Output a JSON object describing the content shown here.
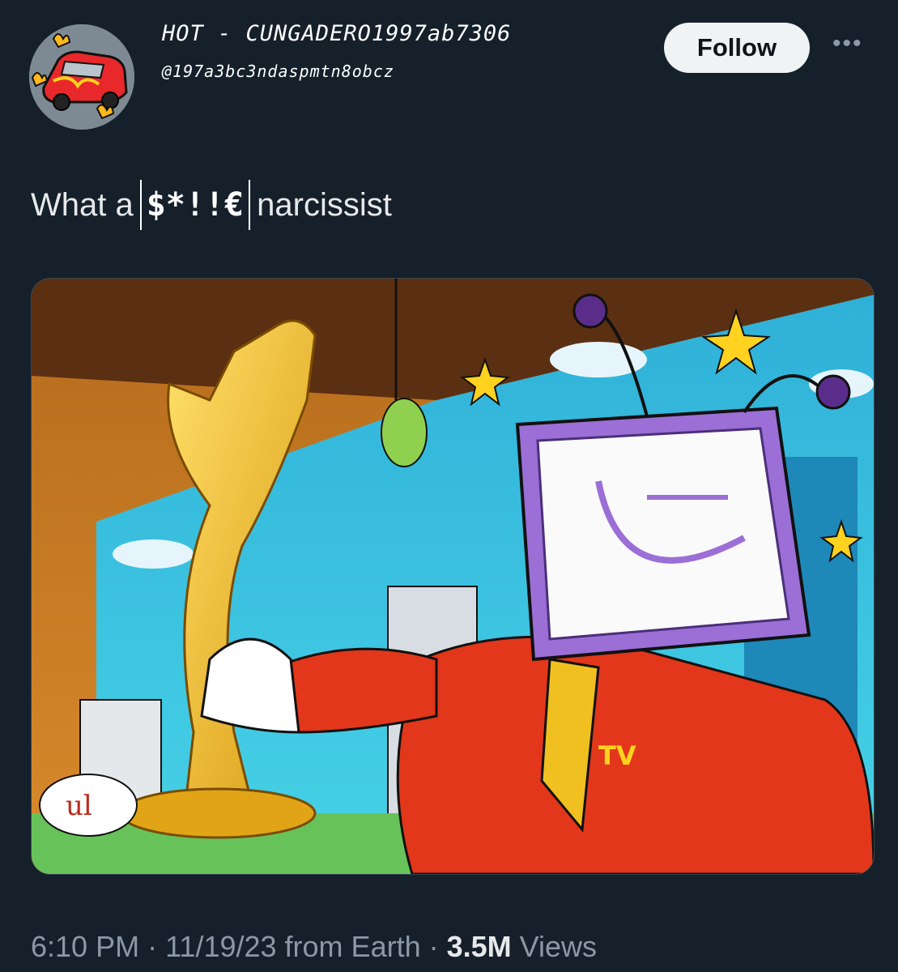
{
  "tweet": {
    "display_name": "HOT - CUNGADERO1997ab7306",
    "handle": "@197a3bc3ndaspmtn8obcz",
    "follow_label": "Follow",
    "more_label": "•••",
    "text_before": "What a",
    "censored": "$*!!€",
    "text_after": "narcissist",
    "media_speech_text": "ul",
    "media_tie_text": "TV"
  },
  "meta": {
    "time": "6:10 PM",
    "sep1": " · ",
    "date": "11/19/23",
    "source": " from Earth",
    "sep2": " · ",
    "views_count": "3.5M",
    "views_label": " Views"
  },
  "colors": {
    "background": "#15202b",
    "follow_bg": "#eff3f4",
    "muted": "#8b98a5"
  },
  "icons": [
    "avatar-car-flames",
    "more-dots-icon"
  ]
}
